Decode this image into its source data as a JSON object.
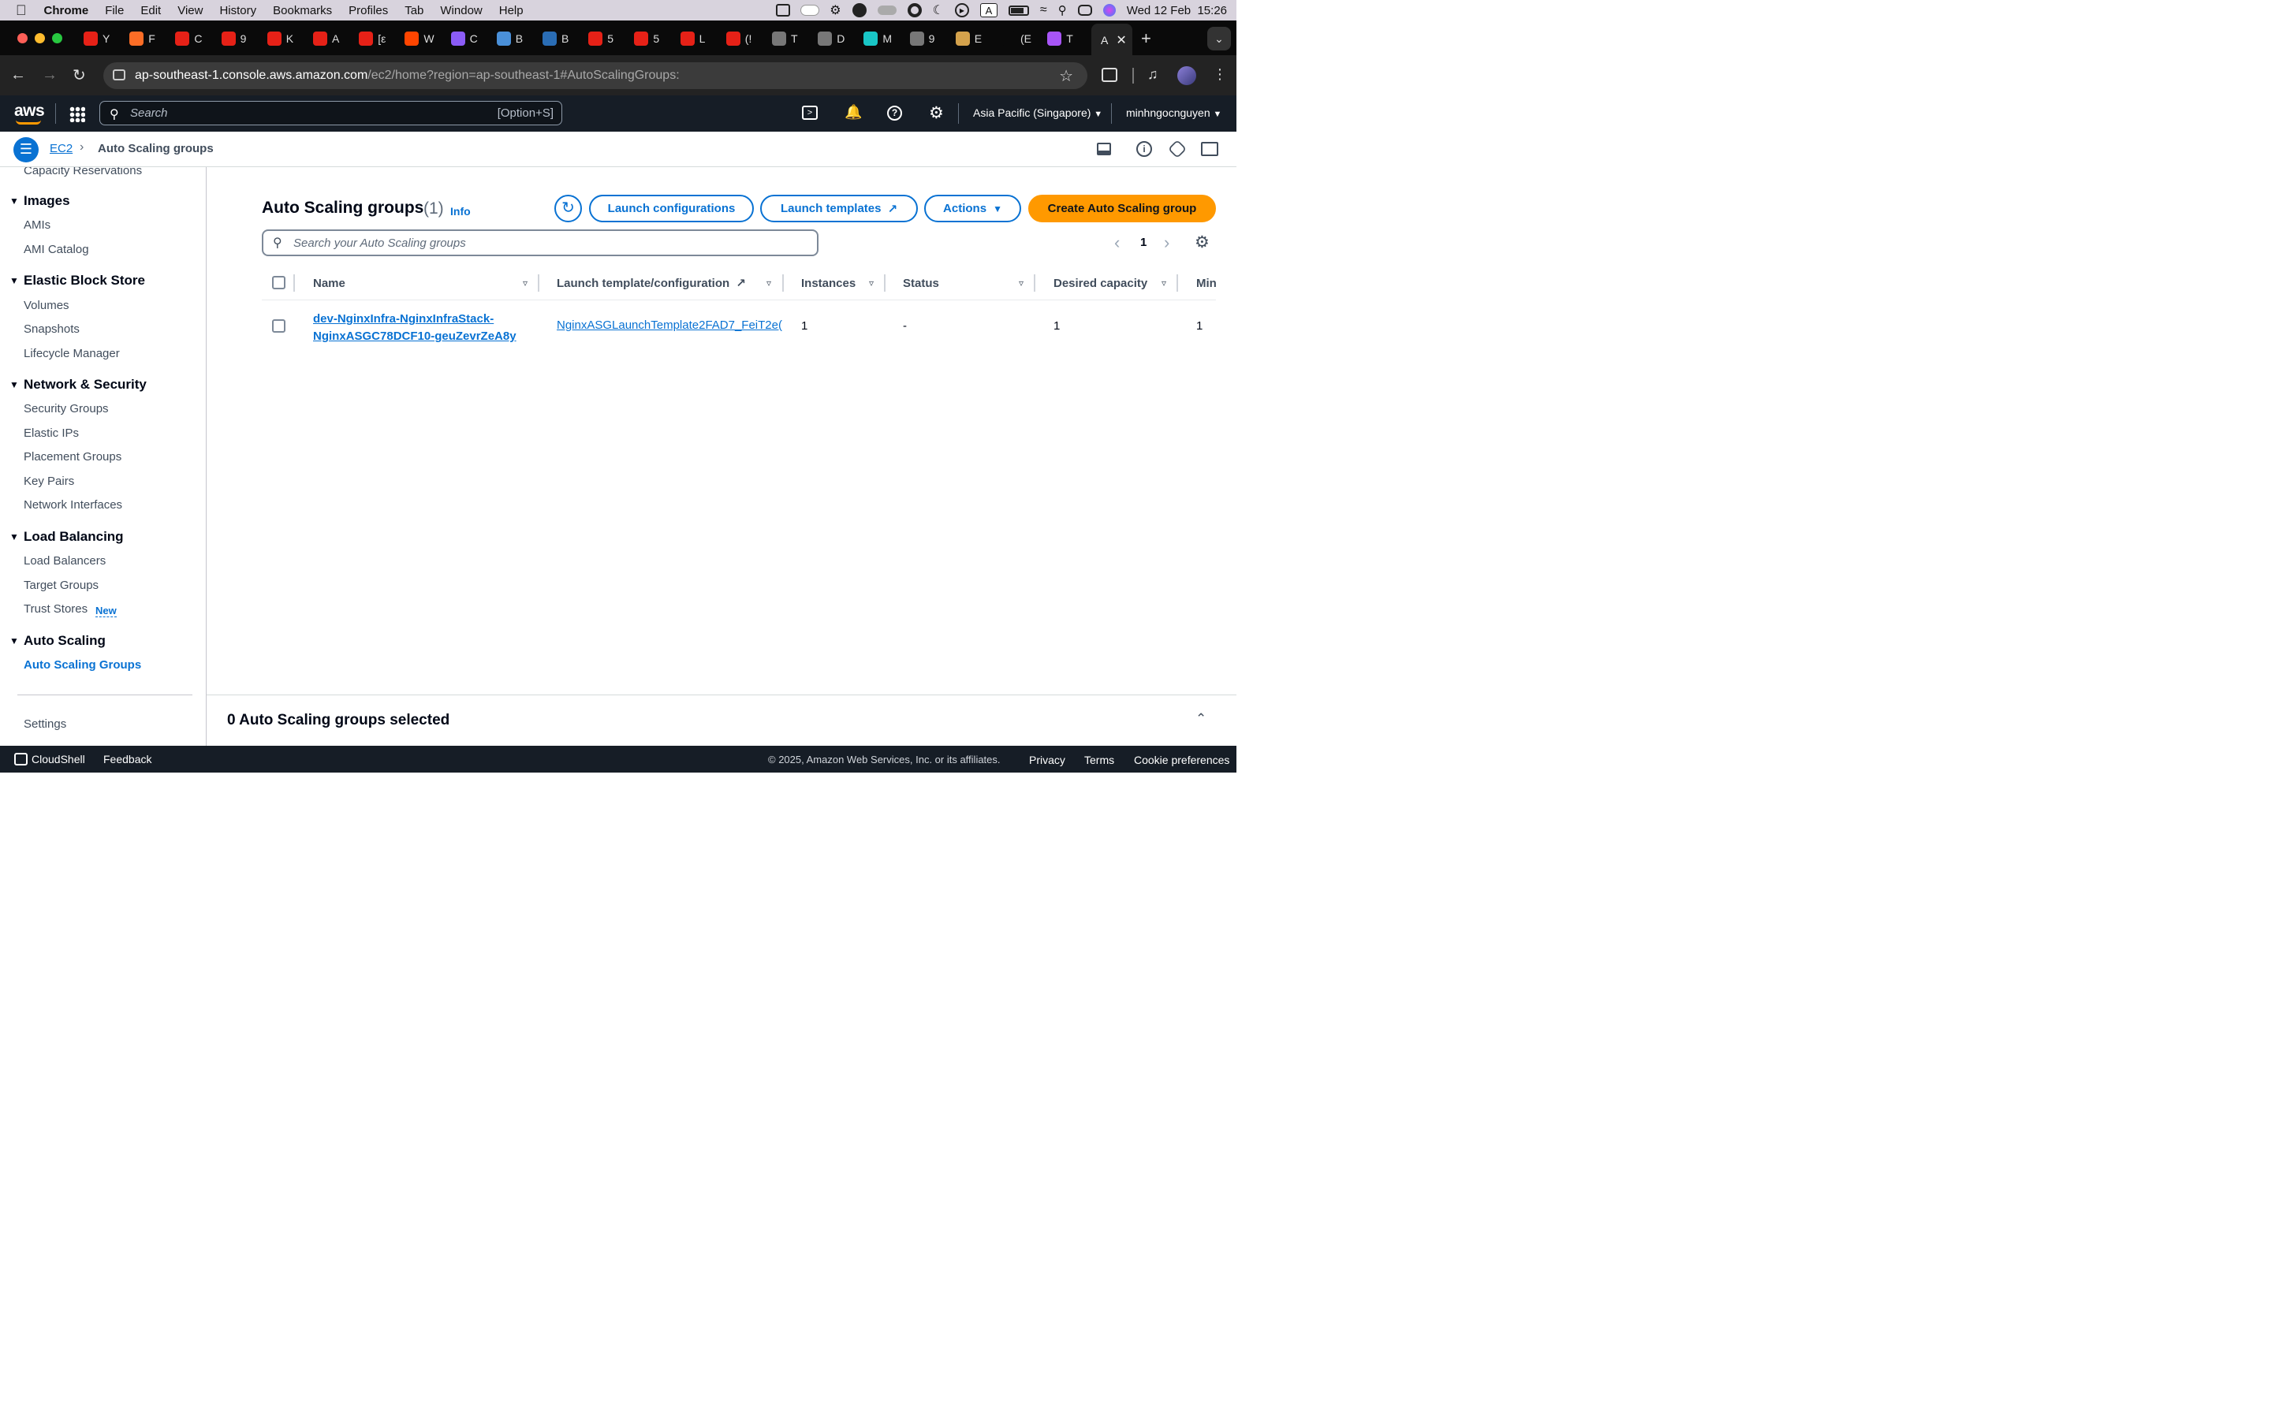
{
  "macbar": {
    "app": "Chrome",
    "menus": [
      "File",
      "Edit",
      "View",
      "History",
      "Bookmarks",
      "Profiles",
      "Tab",
      "Window",
      "Help"
    ],
    "clock": "Wed 12 Feb  15:26",
    "input_indicator": "A"
  },
  "tabs": [
    {
      "letter": "Y",
      "color": "#e62117"
    },
    {
      "letter": "F",
      "color": "#fc6d26"
    },
    {
      "letter": "C",
      "color": "#e62117"
    },
    {
      "letter": "9",
      "color": "#e62117"
    },
    {
      "letter": "K",
      "color": "#e62117"
    },
    {
      "letter": "A",
      "color": "#e62117"
    },
    {
      "letter": "[ε",
      "color": "#e62117"
    },
    {
      "letter": "W",
      "color": "#ff4500"
    },
    {
      "letter": "C",
      "color": "#8b5cf6"
    },
    {
      "letter": "B",
      "color": "#4a90d9"
    },
    {
      "letter": "B",
      "color": "#2a6db5"
    },
    {
      "letter": "5",
      "color": "#e62117"
    },
    {
      "letter": "5",
      "color": "#e62117"
    },
    {
      "letter": "L",
      "color": "#e62117"
    },
    {
      "letter": "(!",
      "color": "#e62117"
    },
    {
      "letter": "T",
      "color": "#777"
    },
    {
      "letter": "D",
      "color": "#777"
    },
    {
      "letter": "M",
      "color": "#19c6c6"
    },
    {
      "letter": "9",
      "color": "#777"
    },
    {
      "letter": "E",
      "color": "#d4a24c"
    },
    {
      "letter": "(E",
      "color": "#0a0a0a"
    },
    {
      "letter": "T",
      "color": "#a855f7"
    },
    {
      "letter": "A",
      "color": "#0a0a0a"
    }
  ],
  "url": {
    "host": "ap-southeast-1.console.aws.amazon.com",
    "path": "/ec2/home?region=ap-southeast-1#AutoScalingGroups:"
  },
  "aws": {
    "logo": "aws",
    "search_placeholder": "Search",
    "search_shortcut": "[Option+S]",
    "region": "Asia Pacific (Singapore)",
    "user": "minhngocnguyen"
  },
  "breadcrumb": {
    "root": "EC2",
    "current": "Auto Scaling groups"
  },
  "sidebar": {
    "partial_top": "Capacity Reservations",
    "sections": [
      {
        "title": "Images",
        "items": [
          "AMIs",
          "AMI Catalog"
        ]
      },
      {
        "title": "Elastic Block Store",
        "items": [
          "Volumes",
          "Snapshots",
          "Lifecycle Manager"
        ]
      },
      {
        "title": "Network & Security",
        "items": [
          "Security Groups",
          "Elastic IPs",
          "Placement Groups",
          "Key Pairs",
          "Network Interfaces"
        ]
      },
      {
        "title": "Load Balancing",
        "items": [
          "Load Balancers",
          "Target Groups",
          "Trust Stores"
        ]
      },
      {
        "title": "Auto Scaling",
        "items": [
          "Auto Scaling Groups"
        ]
      }
    ],
    "new_badge": "New",
    "settings": "Settings"
  },
  "main": {
    "title": "Auto Scaling groups",
    "count": "(1)",
    "info": "Info",
    "buttons": {
      "launch_configurations": "Launch configurations",
      "launch_templates": "Launch templates",
      "actions": "Actions",
      "create": "Create Auto Scaling group"
    },
    "search_placeholder": "Search your Auto Scaling groups",
    "page": "1",
    "columns": [
      "Name",
      "Launch template/configuration",
      "Instances",
      "Status",
      "Desired capacity",
      "Min"
    ],
    "rows": [
      {
        "name_line1": "dev-NginxInfra-NginxInfraStack-",
        "name_line2": "NginxASGC78DCF10-geuZevrZeA8y",
        "template": "NginxASGLaunchTemplate2FAD7_FeiT2e(",
        "instances": "1",
        "status": "-",
        "desired": "1",
        "min": "1"
      }
    ]
  },
  "selection": "0 Auto Scaling groups selected",
  "footer": {
    "cloudshell": "CloudShell",
    "feedback": "Feedback",
    "copyright": "© 2025, Amazon Web Services, Inc. or its affiliates.",
    "privacy": "Privacy",
    "terms": "Terms",
    "cookies": "Cookie preferences"
  },
  "colors": {
    "accent": "#0972d3",
    "primary_button": "#ff9900",
    "nav": "#161d26"
  }
}
